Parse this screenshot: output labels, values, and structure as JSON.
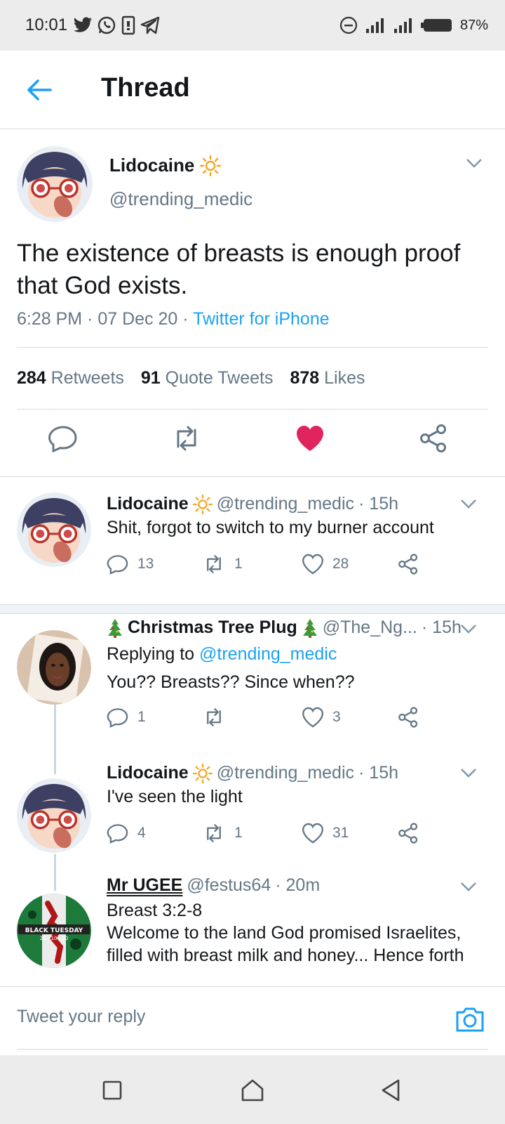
{
  "status_bar": {
    "time": "10:01",
    "battery": "87%"
  },
  "header": {
    "title": "Thread"
  },
  "main_tweet": {
    "name": "Lidocaine",
    "handle": "@trending_medic",
    "text": "The existence of breasts is enough proof that God exists.",
    "time": "6:28 PM",
    "date": "07 Dec 20",
    "source": "Twitter for iPhone",
    "stats": {
      "retweets_count": "284",
      "retweets_label": "Retweets",
      "quotes_count": "91",
      "quotes_label": "Quote Tweets",
      "likes_count": "878",
      "likes_label": "Likes"
    }
  },
  "replies": [
    {
      "name": "Lidocaine",
      "handle": "@trending_medic",
      "time": "· 15h",
      "text": "Shit, forgot to switch to my burner account",
      "replies": "13",
      "retweets": "1",
      "likes": "28"
    },
    {
      "name": "Christmas Tree Plug",
      "handle": "@The_Ng...",
      "time": "· 15h",
      "replying_prefix": "Replying to",
      "replying_to": "@trending_medic",
      "text": "You?? Breasts?? Since when??",
      "replies": "1",
      "retweets": "",
      "likes": "3"
    },
    {
      "name": "Lidocaine",
      "handle": "@trending_medic",
      "time": "· 15h",
      "text": "I've seen the light",
      "replies": "4",
      "retweets": "1",
      "likes": "31"
    },
    {
      "name": "Mr UGEE",
      "handle": "@festus64",
      "time": "· 20m",
      "text_line1": "Breast 3:2-8",
      "text_line2": "Welcome to the land God promised Israelites,",
      "text_line3": "filled with breast milk and honey... Hence forth",
      "avatar_text_1": "BLACK TUESDAY",
      "avatar_text_2": "20 - 10 - 20"
    }
  ],
  "composer": {
    "placeholder": "Tweet your reply"
  },
  "colors": {
    "accent": "#1da1f2",
    "like_red": "#e0245e",
    "muted": "#657786",
    "divider": "#d6dde3"
  },
  "icons": [
    "back-arrow-icon",
    "sun-icon",
    "reply-icon",
    "retweet-icon",
    "heart-icon",
    "share-icon",
    "chevron-down-icon",
    "camera-icon",
    "tree-icon"
  ]
}
